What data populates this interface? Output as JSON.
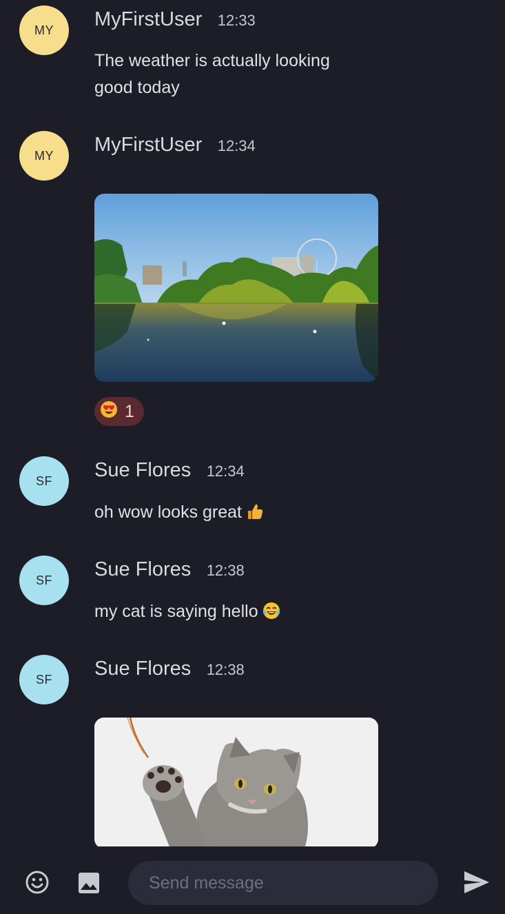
{
  "messages": [
    {
      "initials": "MY",
      "author": "MyFirstUser",
      "time": "12:33",
      "text": "The weather is actually looking good today"
    },
    {
      "initials": "MY",
      "author": "MyFirstUser",
      "time": "12:34",
      "image": "park-lake-with-ferris-wheel",
      "reaction": {
        "emoji": "heart-eyes-emoji",
        "count": "1"
      }
    },
    {
      "initials": "SF",
      "author": "Sue Flores",
      "time": "12:34",
      "text": "oh wow looks great",
      "emoji": "thumbs-up-emoji"
    },
    {
      "initials": "SF",
      "author": "Sue Flores",
      "time": "12:38",
      "text": "my cat is saying hello",
      "emoji": "tears-of-joy-emoji"
    },
    {
      "initials": "SF",
      "author": "Sue Flores",
      "time": "12:38",
      "image": "fluffy-cat-pawing"
    }
  ],
  "composer": {
    "placeholder": "Send message",
    "value": "",
    "icons": [
      "emoji-picker-icon",
      "image-attach-icon",
      "send-icon"
    ]
  },
  "colors": {
    "background": "#1d1d28",
    "avatar_my": "#f7de8c",
    "avatar_sf": "#a7e0ee",
    "reaction_bg": "#5a2a30",
    "input_bg": "#2b2b3a"
  }
}
